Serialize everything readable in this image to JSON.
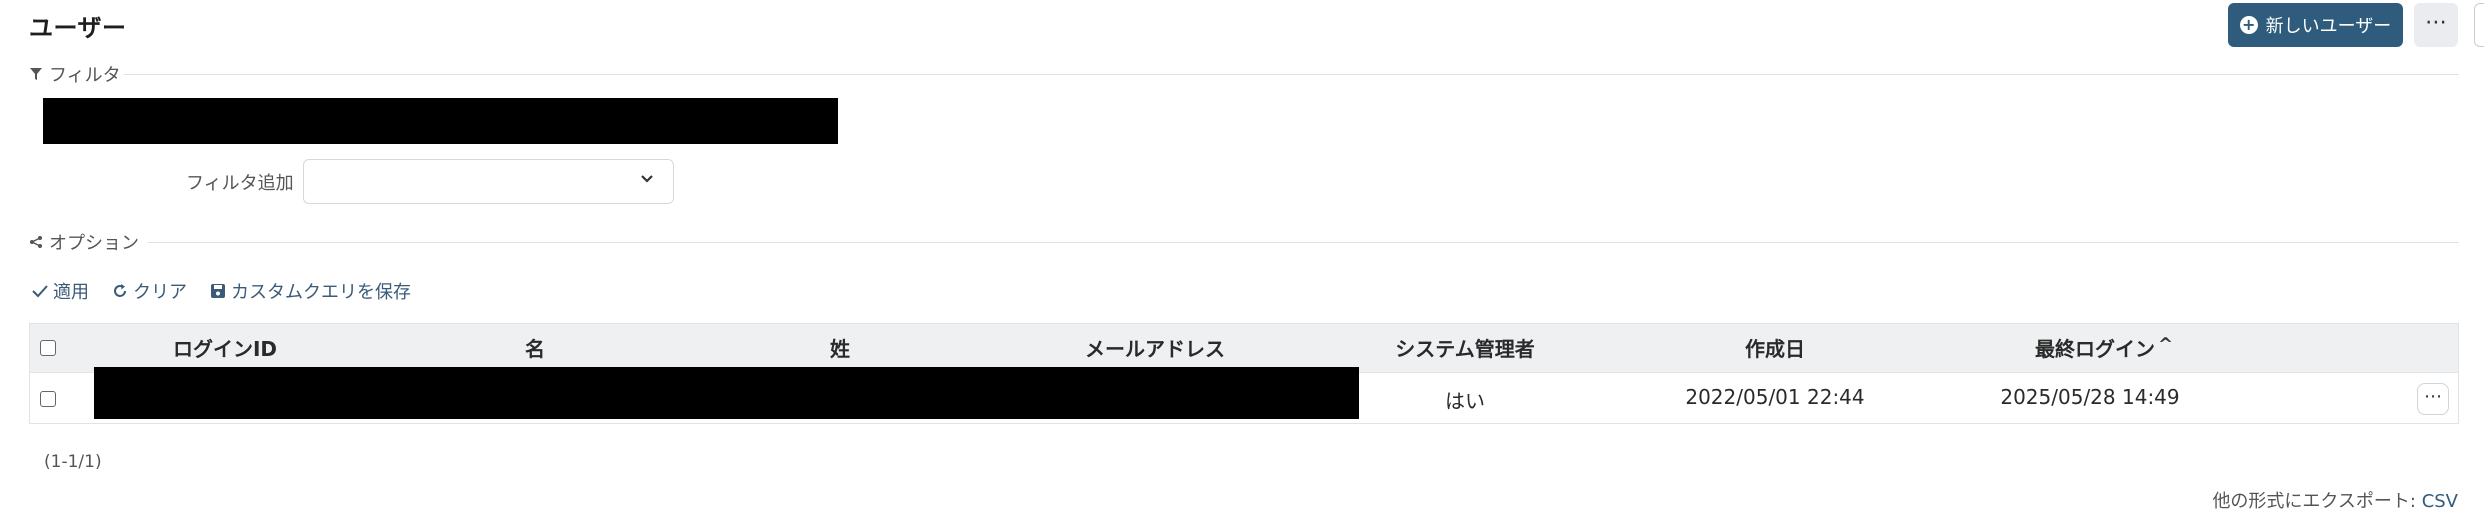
{
  "header": {
    "title": "ユーザー",
    "new_user_label": "新しいユーザー",
    "more_label": "⋯"
  },
  "filter": {
    "legend": "フィルタ",
    "add_filter_label": "フィルタ追加",
    "add_filter_value": ""
  },
  "options": {
    "legend": "オプション",
    "apply_label": "適用",
    "clear_label": "クリア",
    "save_query_label": "カスタムクエリを保存"
  },
  "table": {
    "columns": [
      "ログインID",
      "名",
      "姓",
      "メールアドレス",
      "システム管理者",
      "作成日",
      "最終ログイン"
    ],
    "sort_indicator": "^",
    "rows": [
      {
        "login_id": "",
        "first_name": "",
        "last_name": "",
        "email": "",
        "admin": "はい",
        "created": "2022/05/01 22:44",
        "last_login": "2025/05/28 14:49",
        "more_label": "⋯"
      }
    ]
  },
  "pagination": {
    "text": "(1-1/1)"
  },
  "export": {
    "label": "他の形式にエクスポート: ",
    "csv_label": "CSV"
  },
  "colors": {
    "primary": "#2f5b7c",
    "link": "#3b5b78",
    "table_header_bg": "#eef0f2",
    "redaction": "#000000"
  }
}
